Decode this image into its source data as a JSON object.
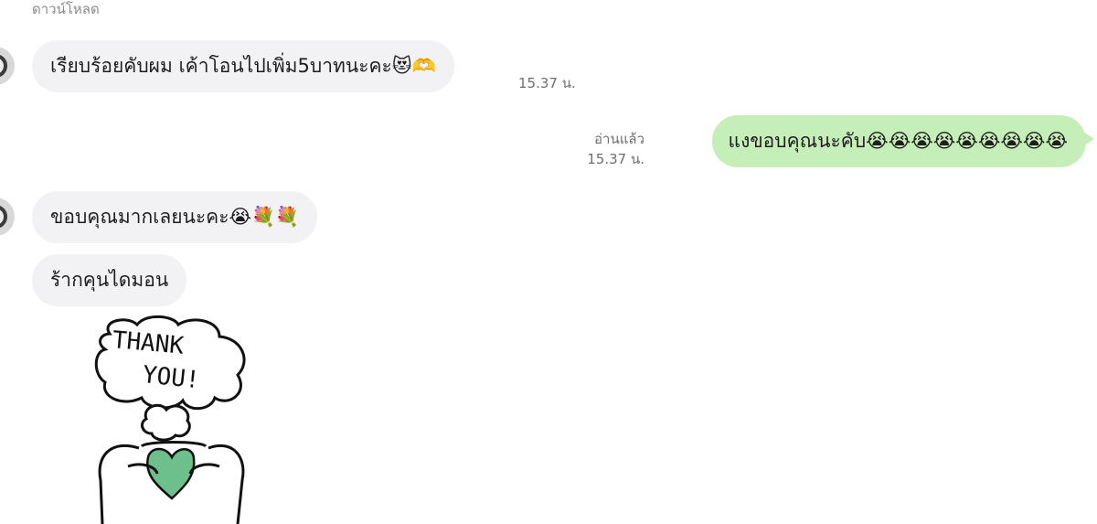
{
  "header": {
    "label": "ดาวน์โหลด"
  },
  "messages": [
    {
      "side": "in",
      "text": "เรียบร้อยคับผม เค้าโอนไปเพิ่ม5บาทนะคะ😻🫶",
      "time": "15.37 น."
    },
    {
      "side": "out",
      "text": "แงขอบคุณนะคับ😭😭😭😭😭😭😭😭😭",
      "read": "อ่านแล้ว",
      "time": "15.37 น."
    },
    {
      "side": "in",
      "text": "ขอบคุณมากเลยนะคะ😭💐💐"
    },
    {
      "side": "in",
      "text": "ร้ากคุนไดมอน"
    }
  ],
  "sticker": {
    "line1": "THANK",
    "line2": "YOU!",
    "heart_color": "#6dbf8b"
  },
  "colors": {
    "incoming_bubble": "#f2f2f4",
    "outgoing_bubble": "#c6eeb9",
    "meta_text": "#6f6f6f"
  }
}
